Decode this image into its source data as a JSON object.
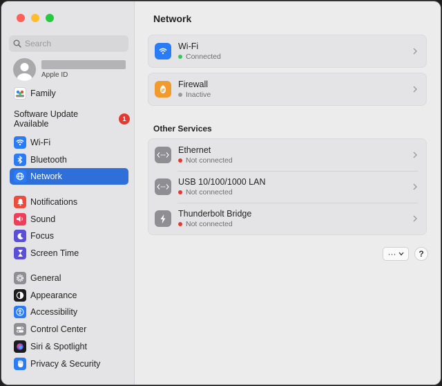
{
  "sidebar": {
    "search_placeholder": "Search",
    "account_sub": "Apple ID",
    "family_label": "Family",
    "software_update": {
      "label": "Software Update Available",
      "count": "1"
    },
    "group1": [
      {
        "label": "Wi-Fi",
        "icon": "wifi-icon",
        "color": "#2a7cf6"
      },
      {
        "label": "Bluetooth",
        "icon": "bluetooth-icon",
        "color": "#2a7cf6"
      },
      {
        "label": "Network",
        "icon": "globe-icon",
        "color": "#2a7cf6",
        "active": true
      }
    ],
    "group2": [
      {
        "label": "Notifications",
        "icon": "bell-icon",
        "color": "#ef4b3c"
      },
      {
        "label": "Sound",
        "icon": "speaker-icon",
        "color": "#ee3e5a"
      },
      {
        "label": "Focus",
        "icon": "moon-icon",
        "color": "#5b4fd8"
      },
      {
        "label": "Screen Time",
        "icon": "hourglass-icon",
        "color": "#5b4fd8"
      }
    ],
    "group3": [
      {
        "label": "General",
        "icon": "gear-icon",
        "color": "#8e8e93"
      },
      {
        "label": "Appearance",
        "icon": "appearance-icon",
        "color": "#1c1c1e"
      },
      {
        "label": "Accessibility",
        "icon": "accessibility-icon",
        "color": "#2a7cf6"
      },
      {
        "label": "Control Center",
        "icon": "control-center-icon",
        "color": "#8e8e93"
      },
      {
        "label": "Siri & Spotlight",
        "icon": "siri-icon",
        "color": "#1c1c1e"
      },
      {
        "label": "Privacy & Security",
        "icon": "hand-icon",
        "color": "#2a7cf6"
      }
    ]
  },
  "main": {
    "title": "Network",
    "top_services": [
      {
        "name": "Wi-Fi",
        "status": "Connected",
        "status_color": "#34c759",
        "icon": "wifi-icon",
        "icon_color": "#2a7cf6"
      },
      {
        "name": "Firewall",
        "status": "Inactive",
        "status_color": "#9a9a9c",
        "icon": "firewall-icon",
        "icon_color": "#f29a2e"
      }
    ],
    "other_services_title": "Other Services",
    "other_services": [
      {
        "name": "Ethernet",
        "status": "Not connected",
        "status_color": "#e5382f",
        "icon": "ethernet-icon",
        "icon_color": "#8e8e93"
      },
      {
        "name": "USB 10/100/1000 LAN",
        "status": "Not connected",
        "status_color": "#e5382f",
        "icon": "ethernet-icon",
        "icon_color": "#8e8e93"
      },
      {
        "name": "Thunderbolt Bridge",
        "status": "Not connected",
        "status_color": "#e5382f",
        "icon": "thunderbolt-icon",
        "icon_color": "#8e8e93"
      }
    ],
    "more_label": "···",
    "help_label": "?"
  }
}
